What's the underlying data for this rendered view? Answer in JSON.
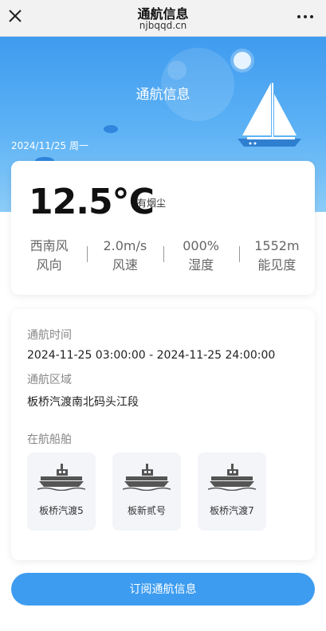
{
  "browser": {
    "title": "通航信息",
    "domain": "njbqqd.cn"
  },
  "hero": {
    "title": "通航信息",
    "date": "2024/11/25 周一"
  },
  "weather": {
    "temperature": "12.5℃",
    "condition": "有烟尘",
    "stats": [
      {
        "value": "西南风",
        "label": "风向"
      },
      {
        "value": "2.0m/s",
        "label": "风速"
      },
      {
        "value": "000%",
        "label": "湿度"
      },
      {
        "value": "1552m",
        "label": "能见度"
      }
    ]
  },
  "navigation": {
    "time_label": "通航时间",
    "time_value": "2024-11-25 03:00:00 - 2024-11-25 24:00:00",
    "area_label": "通航区域",
    "area_value": "板桥汽渡南北码头江段",
    "ships_label": "在航船舶",
    "ships": [
      {
        "name": "板桥汽渡5",
        "icon": "ferry-icon"
      },
      {
        "name": "板新贰号",
        "icon": "ferry-icon"
      },
      {
        "name": "板桥汽渡7",
        "icon": "ferry-icon"
      }
    ]
  },
  "subscribe_label": "订阅通航信息",
  "colors": {
    "accent": "#3d9cf0",
    "hero_top": "#3f9bef",
    "hero_bottom": "#8cccf8"
  }
}
